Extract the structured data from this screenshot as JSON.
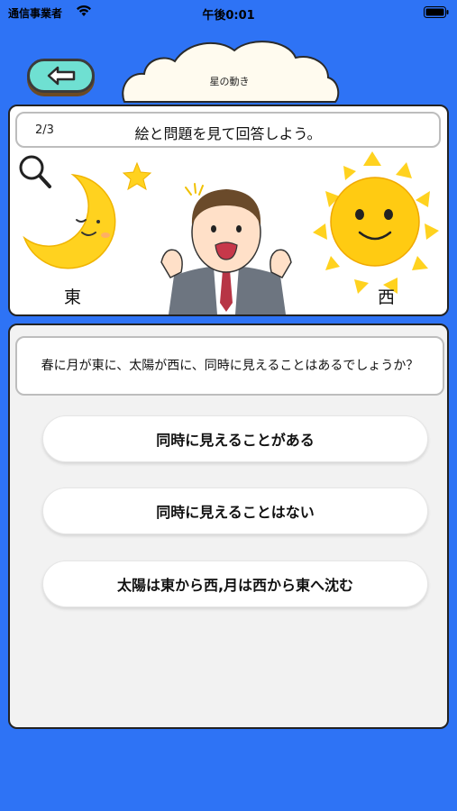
{
  "status_bar": {
    "carrier": "通信事業者",
    "time": "午後0:01"
  },
  "header": {
    "back_icon": "arrow-left-icon",
    "title": "星の動き"
  },
  "top_panel": {
    "progress": "2/3",
    "instruction": "絵と問題を見て回答しよう。",
    "east_label": "東",
    "west_label": "西",
    "icons": [
      "magnifier-icon",
      "moon-icon",
      "star-icon",
      "man-surprised-icon",
      "sun-icon"
    ]
  },
  "question": {
    "text": "春に月が東に、太陽が西に、同時に見えることはあるでしょうか？"
  },
  "options": [
    {
      "label": "同時に見えることがある"
    },
    {
      "label": "同時に見えることはない"
    },
    {
      "label": "太陽は東から西,月は西から東へ沈む"
    }
  ],
  "colors": {
    "background": "#2e73f5",
    "back_button": "#6fe0d2",
    "moon": "#ffd21f",
    "sun": "#ffcb12",
    "panel": "#ffffff",
    "answer_area": "#f2f2f2"
  }
}
